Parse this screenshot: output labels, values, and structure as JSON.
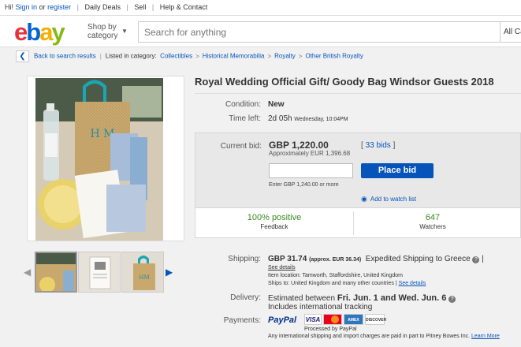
{
  "topbar": {
    "hi": "Hi!",
    "sign_in": "Sign in",
    "or": "or",
    "register": "register",
    "daily_deals": "Daily Deals",
    "sell": "Sell",
    "help": "Help & Contact"
  },
  "header": {
    "logo": [
      "e",
      "b",
      "a",
      "y"
    ],
    "shop_by_line1": "Shop by",
    "shop_by_line2": "category",
    "search_placeholder": "Search for anything",
    "category_select": "All Ca"
  },
  "breadcrumb": {
    "back": "Back to search results",
    "listed_in": "Listed in category:",
    "items": [
      "Collectibles",
      "Historical Memorabilia",
      "Royalty",
      "Other British Royalty"
    ]
  },
  "listing": {
    "title": "Royal Wedding Official Gift/ Goody Bag Windsor Guests 2018",
    "condition_label": "Condition:",
    "condition": "New",
    "time_left_label": "Time left:",
    "time_left": "2d 05h",
    "time_left_detail": "Wednesday, 10:04PM"
  },
  "bid": {
    "current_bid_label": "Current bid:",
    "price": "GBP 1,220.00",
    "approx": "Approximately EUR 1,396.68",
    "bids_link": "33 bids",
    "place_bid": "Place bid",
    "enter_hint": "Enter GBP 1,240.00 or more",
    "watch_list": "Add to watch list",
    "positive": "100% positive",
    "feedback": "Feedback",
    "watchers_count": "647",
    "watchers": "Watchers"
  },
  "shipping": {
    "label": "Shipping:",
    "cost": "GBP 31.74",
    "approx": "(approx. EUR 36.34)",
    "method": "Expedited Shipping to Greece",
    "see_details": "See details",
    "item_location": "Item location:  Tamworth, Staffordshire, United Kingdom",
    "ships_to": "Ships to:  United Kingdom and many other countries",
    "see_details2": "See details"
  },
  "delivery": {
    "label": "Delivery:",
    "estimated": "Estimated between",
    "range": "Fri. Jun. 1 and Wed. Jun. 6",
    "tracking": "Includes international tracking"
  },
  "payments": {
    "label": "Payments:",
    "paypal": "PayPal",
    "cards": [
      "VISA",
      "MC",
      "AMEX",
      "DISCOVER"
    ],
    "processed": "Processed by PayPal",
    "note": "Any international shipping and import charges are paid in part to Pitney Bowes Inc.",
    "learn_more": "Learn More"
  },
  "colors": {
    "link": "#0654ba",
    "positive": "#3a8a1d",
    "button": "#0654ba"
  }
}
